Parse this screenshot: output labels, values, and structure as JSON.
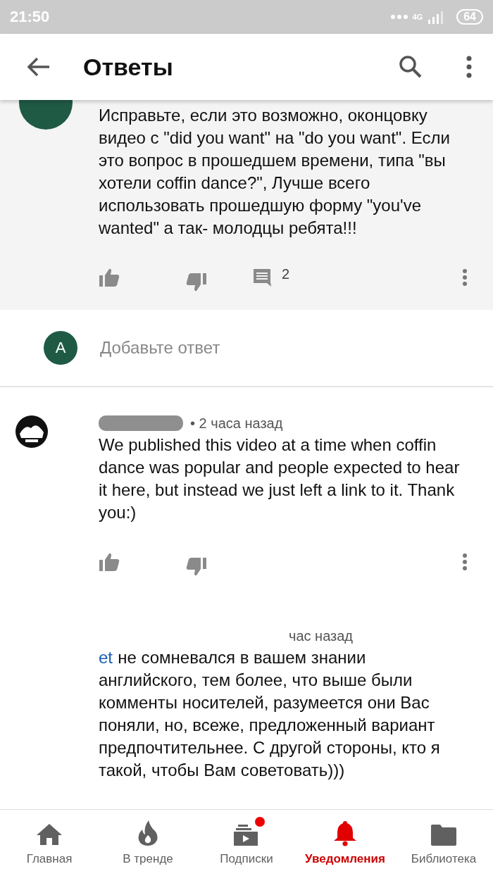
{
  "status_bar": {
    "time": "21:50",
    "network": "4G",
    "battery": "64"
  },
  "header": {
    "title": "Ответы"
  },
  "comments": [
    {
      "highlighted": true,
      "avatar": {
        "kind": "plain"
      },
      "text": "Исправьте, если это возможно, оконцовку видео с \"did you want\"  на \"do you want\". Если это вопрос в прошедшем времени, типа \"вы хотели coffin dance?\", Лучше всего использовать  прошедшую форму \"you've wanted\" а так- молодцы ребята!!!",
      "reply_count": "2"
    },
    {
      "highlighted": false,
      "avatar": {
        "kind": "logo"
      },
      "badge": true,
      "time": "• 2 часа назад",
      "text": "We published this video at a time when coffin dance was popular and people expected to hear it here, but instead we just left a link to it. Thank you:)"
    },
    {
      "highlighted": false,
      "time": "час назад",
      "link": "et",
      "text": "не сомневался в вашем знании английского, тем более, что выше были комменты носителей, разумеется они Вас поняли, но, всеже, предложенный вариант предпочтительнее. С другой стороны, кто я такой, чтобы Вам советовать)))"
    }
  ],
  "reply_box": {
    "avatar": "A",
    "placeholder": "Добавьте ответ"
  },
  "nav": [
    {
      "kind": "home",
      "label": "Главная",
      "selected": false,
      "dot": false
    },
    {
      "kind": "flame",
      "label": "В тренде",
      "selected": false,
      "dot": false
    },
    {
      "kind": "subs",
      "label": "Подписки",
      "selected": false,
      "dot": true
    },
    {
      "kind": "bell",
      "label": "Уведомления",
      "selected": true,
      "dot": false
    },
    {
      "kind": "folder",
      "label": "Библиотека",
      "selected": false,
      "dot": false
    }
  ]
}
